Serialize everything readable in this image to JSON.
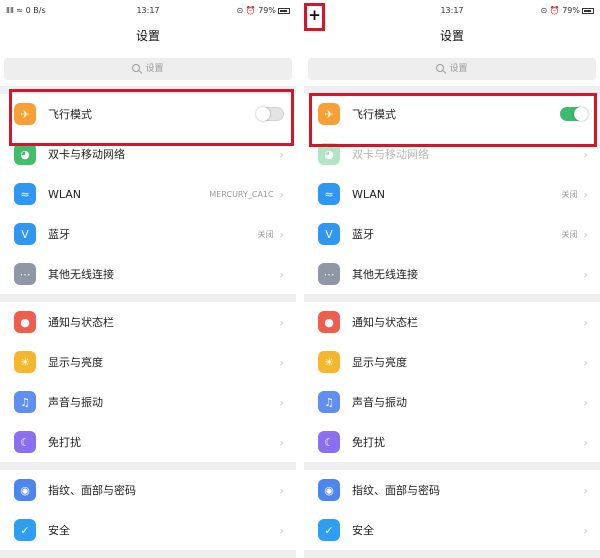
{
  "colors": {
    "airplane": "#f6a035",
    "sim": "#3fbf6a",
    "wlan": "#2e97f3",
    "bluetooth": "#2e97f3",
    "more": "#8f97a6",
    "notify": "#f05c4d",
    "display": "#f5b62c",
    "sound": "#5f8ff0",
    "dnd": "#8a6ff2",
    "fingerprint": "#4a86ee",
    "security": "#2e9ef2",
    "toggle_on": "#3fb96e",
    "highlight": "#d7152a"
  },
  "left": {
    "status": {
      "signal": "ⅡⅡ ≈ 0 B/s",
      "time": "13:17",
      "right": "⊙ ⏰ 79%"
    },
    "title": "设置",
    "search_placeholder": "设置",
    "groups": [
      [
        {
          "icon": "airplane-icon",
          "label": "飞行模式",
          "toggle": "off"
        },
        {
          "icon": "sim-icon",
          "label": "双卡与移动网络",
          "value": ""
        },
        {
          "icon": "wlan-icon",
          "label": "WLAN",
          "value": "MERCURY_CA1C"
        },
        {
          "icon": "bluetooth-icon",
          "label": "蓝牙",
          "value": "关闭"
        },
        {
          "icon": "more-icon",
          "label": "其他无线连接",
          "value": ""
        }
      ],
      [
        {
          "icon": "notify-icon",
          "label": "通知与状态栏"
        },
        {
          "icon": "display-icon",
          "label": "显示与亮度"
        },
        {
          "icon": "sound-icon",
          "label": "声音与振动"
        },
        {
          "icon": "dnd-icon",
          "label": "免打扰"
        }
      ],
      [
        {
          "icon": "fingerprint-icon",
          "label": "指纹、面部与密码"
        },
        {
          "icon": "security-icon",
          "label": "安全"
        }
      ]
    ]
  },
  "right": {
    "status": {
      "signal": "✈",
      "time": "13:17",
      "right": "⊙ ⏰ 79%"
    },
    "title": "设置",
    "search_placeholder": "设置",
    "plus_label": "+",
    "groups": [
      [
        {
          "icon": "airplane-icon",
          "label": "飞行模式",
          "toggle": "on"
        },
        {
          "icon": "sim-icon",
          "label": "双卡与移动网络",
          "value": ""
        },
        {
          "icon": "wlan-icon",
          "label": "WLAN",
          "value": "关闭"
        },
        {
          "icon": "bluetooth-icon",
          "label": "蓝牙",
          "value": "关闭"
        },
        {
          "icon": "more-icon",
          "label": "其他无线连接",
          "value": ""
        }
      ],
      [
        {
          "icon": "notify-icon",
          "label": "通知与状态栏"
        },
        {
          "icon": "display-icon",
          "label": "显示与亮度"
        },
        {
          "icon": "sound-icon",
          "label": "声音与振动"
        },
        {
          "icon": "dnd-icon",
          "label": "免打扰"
        }
      ],
      [
        {
          "icon": "fingerprint-icon",
          "label": "指纹、面部与密码"
        },
        {
          "icon": "security-icon",
          "label": "安全"
        }
      ]
    ]
  }
}
